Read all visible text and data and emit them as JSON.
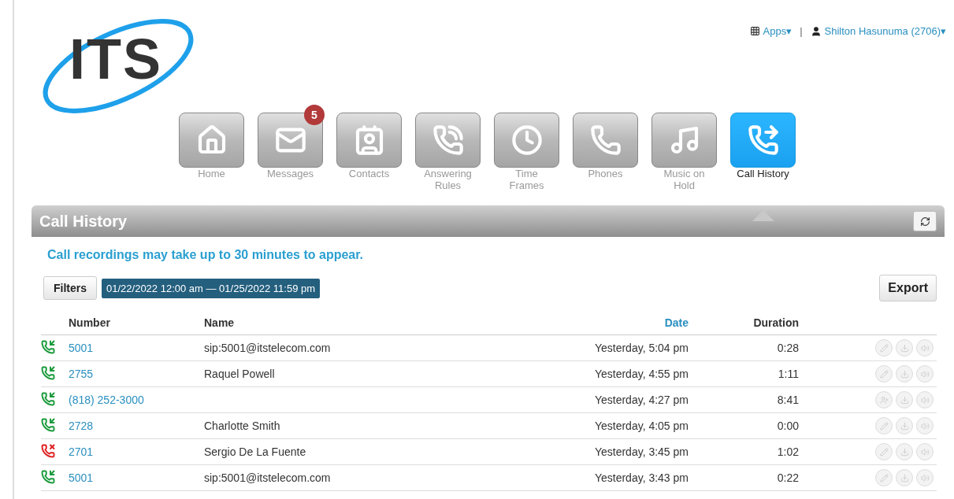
{
  "logo": {
    "text": "ITS"
  },
  "top_bar": {
    "apps": "Apps",
    "apps_caret": "▾",
    "separator": "|",
    "user": "Shilton Hasunuma (2706)",
    "user_caret": "▾"
  },
  "nav": [
    {
      "kind": "home",
      "label": "Home",
      "selected": false
    },
    {
      "kind": "mail",
      "label": "Messages",
      "selected": false,
      "badge": "5"
    },
    {
      "kind": "contact",
      "label": "Contacts",
      "selected": false
    },
    {
      "kind": "ringing",
      "label": "Answering Rules",
      "selected": false
    },
    {
      "kind": "clock",
      "label": "Time Frames",
      "selected": false
    },
    {
      "kind": "phone",
      "label": "Phones",
      "selected": false
    },
    {
      "kind": "music",
      "label": "Music on Hold",
      "selected": false
    },
    {
      "kind": "history",
      "label": "Call History",
      "selected": true
    }
  ],
  "panel": {
    "title": "Call History",
    "notice": "Call recordings may take up to 30 minutes to appear.",
    "filters_button": "Filters",
    "date_range": "01/22/2022 12:00 am — 01/25/2022 11:59 pm",
    "export_button": "Export"
  },
  "table": {
    "columns": [
      {
        "label": "Number",
        "sorted": false
      },
      {
        "label": "Name",
        "sorted": false
      },
      {
        "label": "Date",
        "sorted": true
      },
      {
        "label": "Duration",
        "sorted": false
      }
    ],
    "rows": [
      {
        "kind": "answered",
        "number": "5001",
        "name": "sip:5001@itstelecom.com",
        "date": "Yesterday, 5:04 pm",
        "duration": "0:28",
        "actions": [
          {
            "kind": "note"
          },
          {
            "kind": "download"
          },
          {
            "kind": "play"
          }
        ]
      },
      {
        "kind": "answered",
        "number": "2755",
        "name": "Raquel Powell",
        "date": "Yesterday, 4:55 pm",
        "duration": "1:11",
        "actions": [
          {
            "kind": "note"
          },
          {
            "kind": "download"
          },
          {
            "kind": "play"
          }
        ]
      },
      {
        "kind": "answered",
        "number": "(818) 252-3000",
        "date": "Yesterday, 4:27 pm",
        "duration": "8:41",
        "actions": [
          {
            "kind": "add_contact"
          },
          {
            "kind": "download"
          },
          {
            "kind": "play"
          }
        ]
      },
      {
        "kind": "answered",
        "number": "2728",
        "name": "Charlotte Smith",
        "date": "Yesterday, 4:05 pm",
        "duration": "0:00",
        "actions": [
          {
            "kind": "note"
          },
          {
            "kind": "download"
          },
          {
            "kind": "play"
          }
        ]
      },
      {
        "kind": "missed",
        "number": "2701",
        "name": "Sergio De La Fuente",
        "date": "Yesterday, 3:45 pm",
        "duration": "1:02",
        "actions": [
          {
            "kind": "note"
          },
          {
            "kind": "download"
          },
          {
            "kind": "play"
          }
        ]
      },
      {
        "kind": "answered",
        "number": "5001",
        "name": "sip:5001@itstelecom.com",
        "date": "Yesterday, 3:43 pm",
        "duration": "0:22",
        "actions": [
          {
            "kind": "note"
          },
          {
            "kind": "download"
          },
          {
            "kind": "play"
          }
        ]
      }
    ]
  }
}
